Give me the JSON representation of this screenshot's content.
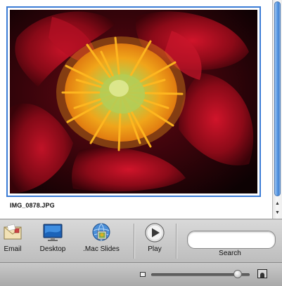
{
  "viewer": {
    "filename": "IMG_0878.JPG",
    "photo_subject": "red-peony-photo"
  },
  "toolbar": {
    "email_label": "Email",
    "desktop_label": "Desktop",
    "mac_slides_label": ".Mac Slides",
    "play_label": "Play",
    "search_label": "Search",
    "search_value": ""
  },
  "zoom": {
    "level": 0.88
  },
  "colors": {
    "selection_border": "#3a7bd5",
    "scroll_thumb": "#5f9ee6",
    "toolbar_bg": "#cfcfcf"
  },
  "icons": {
    "email": "envelope-icon",
    "desktop": "desktop-icon",
    "mac_slides": "mac-slides-icon",
    "play": "play-icon",
    "small_thumb": "small-thumbnail-icon",
    "large_thumb": "large-thumbnail-icon"
  }
}
